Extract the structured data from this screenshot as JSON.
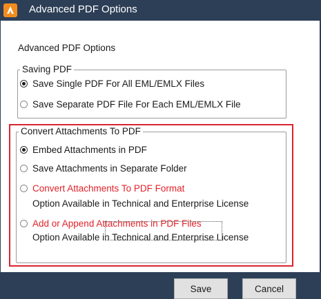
{
  "window": {
    "title": "Advanced PDF Options",
    "icon": "app-logo-icon",
    "accent_color": "#2d3f57"
  },
  "heading": "Advanced PDF Options",
  "saving_pdf": {
    "legend": "Saving PDF",
    "options": [
      {
        "label": "Save Single PDF For All EML/EMLX Files",
        "selected": true
      },
      {
        "label": "Save Separate PDF File For Each EML/EMLX File",
        "selected": false
      }
    ]
  },
  "convert_attachments": {
    "legend": "Convert Attachments To PDF",
    "highlight_color": "#d9232e",
    "options": [
      {
        "label": "Embed Attachments in PDF",
        "selected": true
      },
      {
        "label": "Save Attachments in Separate Folder",
        "selected": false
      },
      {
        "label": "Convert Attachments To PDF Format",
        "selected": false,
        "note": "Option Available in Technical and Enterprise License"
      },
      {
        "label": "Add or Append Attachments in PDF Files",
        "selected": false,
        "note": "Option Available in Technical and Enterprise License"
      }
    ]
  },
  "buttons": {
    "save": "Save",
    "cancel": "Cancel"
  }
}
